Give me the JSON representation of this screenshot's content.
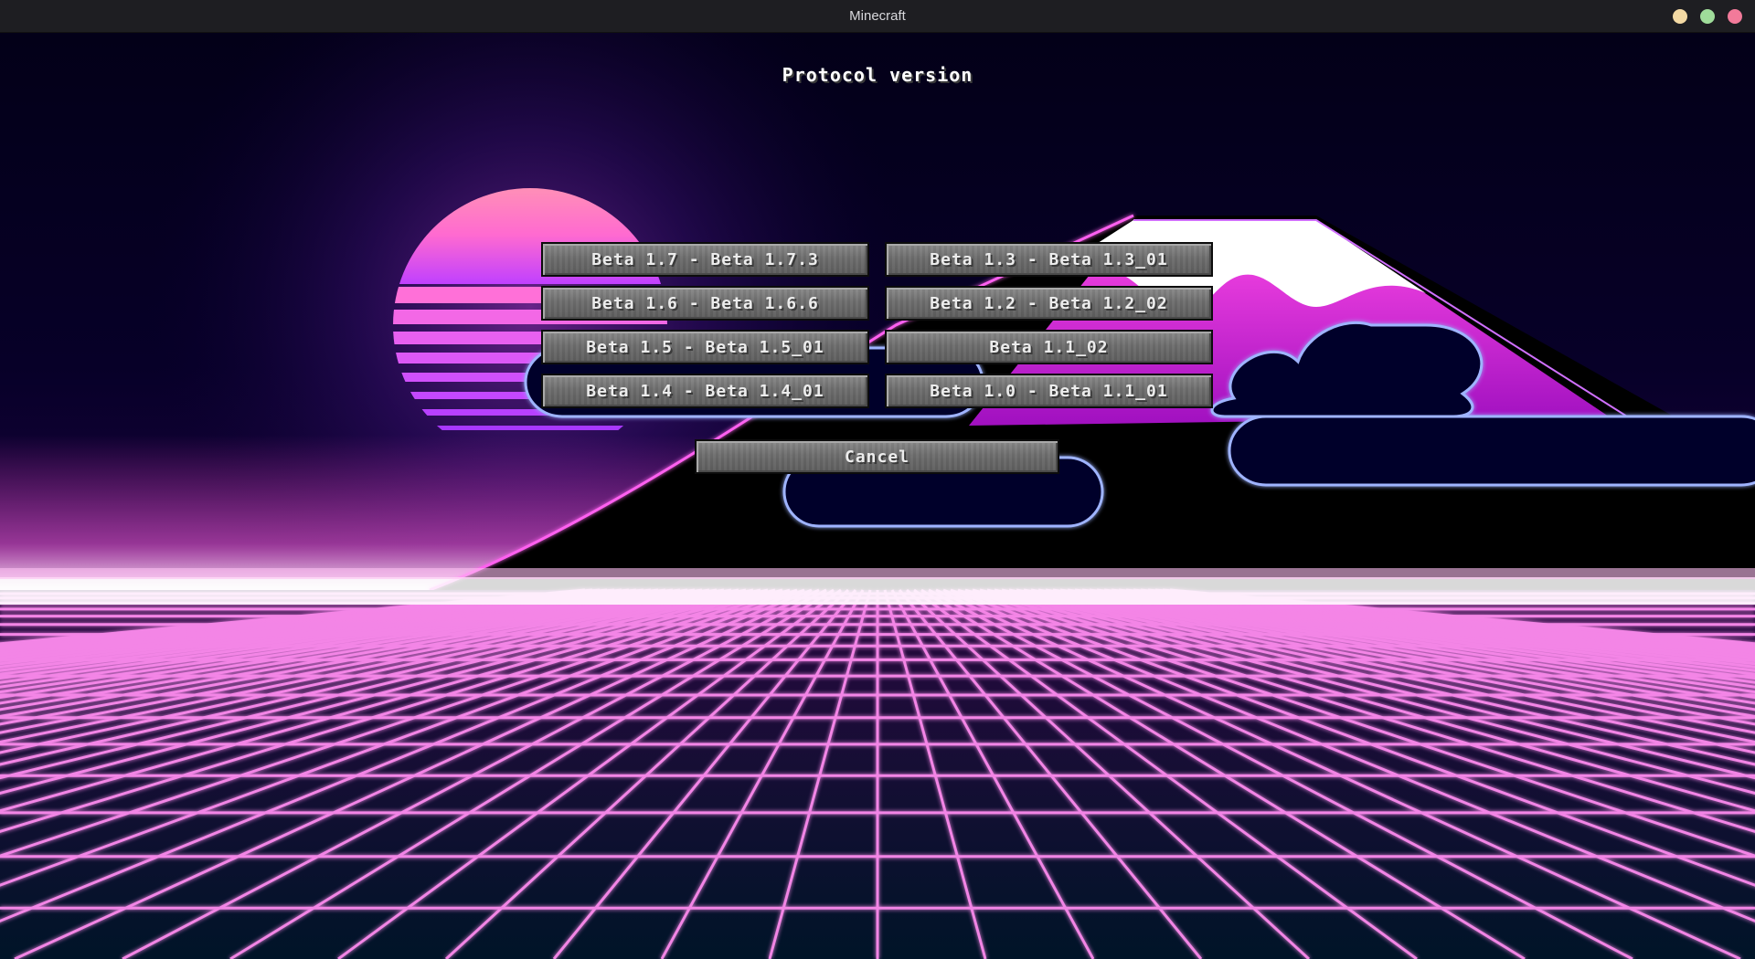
{
  "window": {
    "title": "Minecraft",
    "controls": [
      {
        "name": "minimize",
        "color": "#f3d9a4"
      },
      {
        "name": "maximize",
        "color": "#9fdc9a"
      },
      {
        "name": "close",
        "color": "#f27a9a"
      }
    ]
  },
  "screen": {
    "title": "Protocol version",
    "versions": {
      "left": [
        "Beta 1.7 - Beta 1.7.3",
        "Beta 1.6 - Beta 1.6.6",
        "Beta 1.5 - Beta 1.5_01",
        "Beta 1.4 - Beta 1.4_01"
      ],
      "right": [
        "Beta 1.3 - Beta 1.3_01",
        "Beta 1.2 - Beta 1.2_02",
        "Beta 1.1_02",
        "Beta 1.0 - Beta 1.1_01"
      ]
    },
    "cancel_label": "Cancel"
  },
  "colors": {
    "sky": "#05001f",
    "sun": "#ff7fbf",
    "grid": "#ff8cf0",
    "mountain": "#e040e0"
  }
}
